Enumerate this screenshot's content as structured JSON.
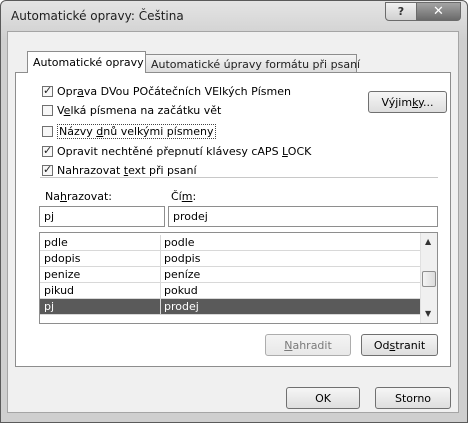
{
  "window": {
    "title": "Automatické opravy: Čeština",
    "help": "?",
    "close": "✕"
  },
  "tabs": [
    {
      "label": "Automatické opravy",
      "active": true
    },
    {
      "label": "Automatické úpravy formátu při psaní",
      "active": false
    }
  ],
  "options": [
    {
      "pre": "Opr",
      "key": "a",
      "post": "va DVou POčátečních VElkých Písmen",
      "checked": true
    },
    {
      "pre": "V",
      "key": "e",
      "post": "lká písmena na začátku vět",
      "checked": false
    },
    {
      "pre": "Názvy ",
      "key": "d",
      "post": "nů velkými písmeny",
      "checked": false
    },
    {
      "pre": "Opravit nechtěné přepnutí klávesy cAPS ",
      "key": "L",
      "post": "OCK",
      "checked": true
    },
    {
      "pre": "Nahrazovat ",
      "key": "t",
      "post": "ext při psaní",
      "checked": true
    }
  ],
  "exceptions_button": {
    "pre": "Výjim",
    "key": "k",
    "post": "y..."
  },
  "replace_label": {
    "pre": "Na",
    "key": "h",
    "post": "razovat:"
  },
  "with_label": {
    "pre": "Čí",
    "key": "m",
    "post": ":"
  },
  "replace_value": "pj",
  "with_value": "prodej",
  "entries": [
    {
      "from": "pdle",
      "to": "podle",
      "selected": false
    },
    {
      "from": "pdopis",
      "to": "podpis",
      "selected": false
    },
    {
      "from": "penize",
      "to": "peníze",
      "selected": false
    },
    {
      "from": "pikud",
      "to": "pokud",
      "selected": false
    },
    {
      "from": "pj",
      "to": "prodej",
      "selected": true
    }
  ],
  "replace_button": {
    "pre": "",
    "key": "N",
    "post": "ahradit",
    "disabled": true
  },
  "delete_button": {
    "pre": "Od",
    "key": "s",
    "post": "tranit"
  },
  "ok_button": "OK",
  "cancel_button": "Storno",
  "colors": {
    "selection": "#5a5a5a",
    "panel": "#f0f0f0"
  }
}
